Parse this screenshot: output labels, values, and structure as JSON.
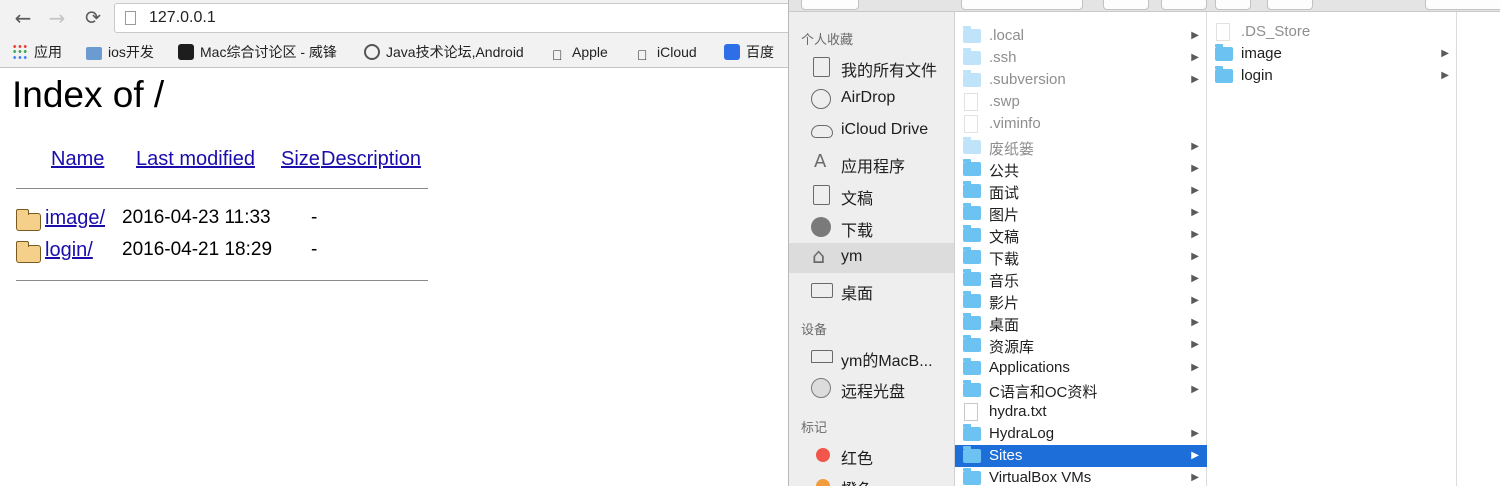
{
  "browser": {
    "nav": {
      "back": "←",
      "forward": "→",
      "reload": "⟳"
    },
    "url": "127.0.0.1",
    "bookmarks": [
      {
        "label": "应用",
        "icon": "apps-grid-icon"
      },
      {
        "label": "ios开发",
        "icon": "folder-icon"
      },
      {
        "label": "Mac综合讨论区 - 威锋",
        "icon": "mac-forum-icon"
      },
      {
        "label": "Java技术论坛,Android",
        "icon": "java-forum-icon"
      },
      {
        "label": "Apple",
        "icon": "apple-icon"
      },
      {
        "label": "iCloud",
        "icon": "apple-icon"
      },
      {
        "label": "百度",
        "icon": "baidu-paw-icon"
      }
    ],
    "page": {
      "title": "Index of /",
      "columns": [
        "Name",
        "Last modified",
        "Size",
        "Description"
      ],
      "entries": [
        {
          "name": "image/",
          "modified": "2016-04-23 11:33",
          "size": "-"
        },
        {
          "name": "login/",
          "modified": "2016-04-21 18:29",
          "size": "-"
        }
      ]
    }
  },
  "finder": {
    "sidebar": {
      "favorites_heading": "个人收藏",
      "favorites": [
        {
          "label": "我的所有文件",
          "icon": "all-files-icon"
        },
        {
          "label": "AirDrop",
          "icon": "airdrop-icon"
        },
        {
          "label": "iCloud Drive",
          "icon": "cloud-icon"
        },
        {
          "label": "应用程序",
          "icon": "applications-icon"
        },
        {
          "label": "文稿",
          "icon": "documents-icon"
        },
        {
          "label": "下载",
          "icon": "downloads-icon"
        },
        {
          "label": "ym",
          "icon": "home-icon",
          "selected": true
        },
        {
          "label": "桌面",
          "icon": "desktop-icon"
        }
      ],
      "devices_heading": "设备",
      "devices": [
        {
          "label": "ym的MacB...",
          "icon": "laptop-icon"
        },
        {
          "label": "远程光盘",
          "icon": "disc-icon"
        }
      ],
      "tags_heading": "标记",
      "tags": [
        {
          "label": "红色",
          "color": "#f2564b"
        },
        {
          "label": "橙色",
          "color": "#f39c3d"
        }
      ]
    },
    "column1": [
      {
        "label": ".local",
        "type": "folder",
        "hidden": true
      },
      {
        "label": ".ssh",
        "type": "folder",
        "hidden": true
      },
      {
        "label": ".subversion",
        "type": "folder",
        "hidden": true
      },
      {
        "label": ".swp",
        "type": "file",
        "hidden": true
      },
      {
        "label": ".viminfo",
        "type": "file",
        "hidden": true
      },
      {
        "label": "废纸篓",
        "type": "folder",
        "hidden": true
      },
      {
        "label": "公共",
        "type": "folder"
      },
      {
        "label": "面试",
        "type": "folder"
      },
      {
        "label": "图片",
        "type": "folder"
      },
      {
        "label": "文稿",
        "type": "folder"
      },
      {
        "label": "下载",
        "type": "folder"
      },
      {
        "label": "音乐",
        "type": "folder"
      },
      {
        "label": "影片",
        "type": "folder"
      },
      {
        "label": "桌面",
        "type": "folder"
      },
      {
        "label": "资源库",
        "type": "folder"
      },
      {
        "label": "Applications",
        "type": "folder"
      },
      {
        "label": "C语言和OC资料",
        "type": "folder"
      },
      {
        "label": "hydra.txt",
        "type": "file"
      },
      {
        "label": "HydraLog",
        "type": "folder"
      },
      {
        "label": "Sites",
        "type": "folder",
        "selected": true
      },
      {
        "label": "VirtualBox VMs",
        "type": "folder"
      }
    ],
    "column2": [
      {
        "label": ".DS_Store",
        "type": "file",
        "hidden": true
      },
      {
        "label": "image",
        "type": "folder"
      },
      {
        "label": "login",
        "type": "folder"
      }
    ]
  }
}
